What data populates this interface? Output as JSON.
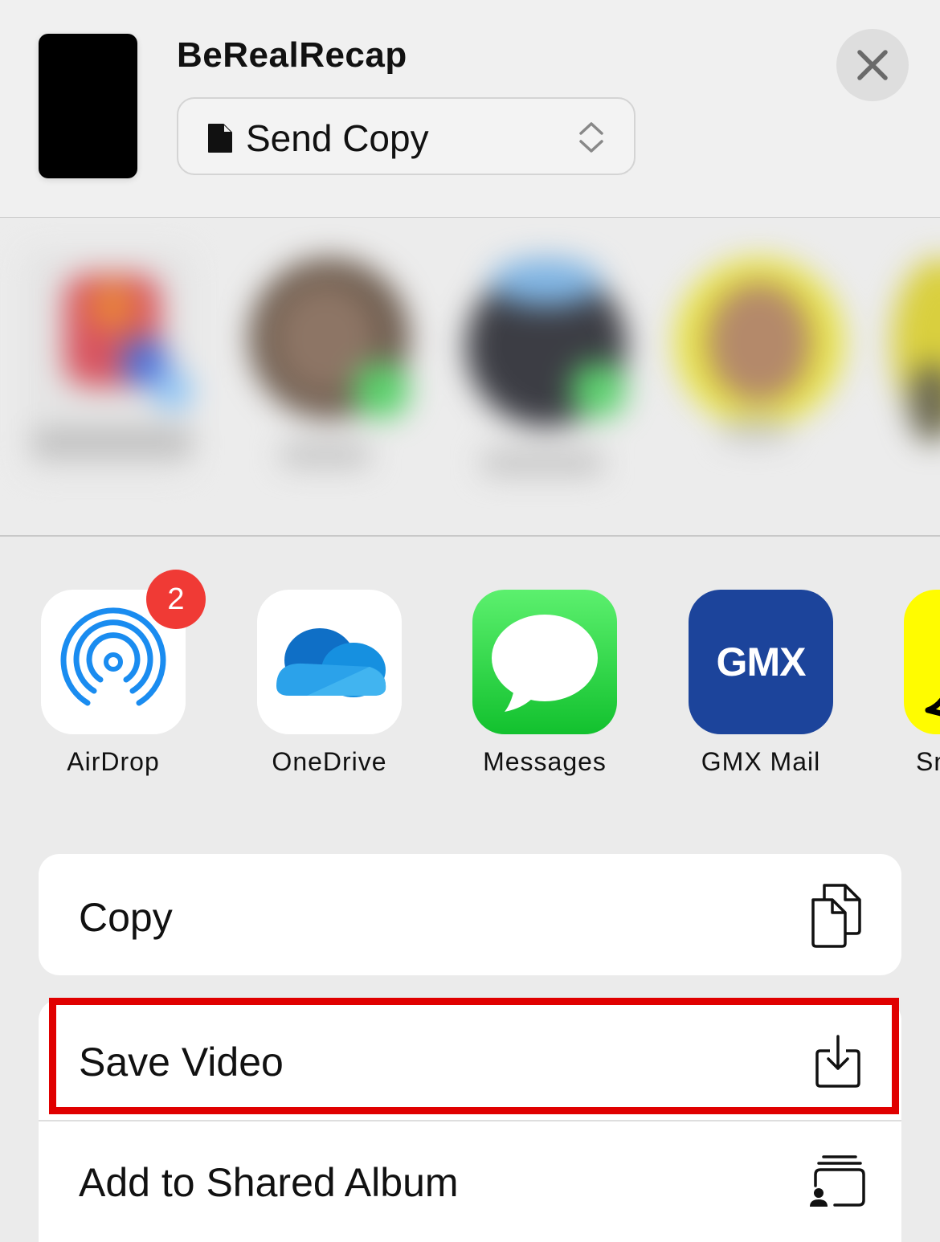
{
  "header": {
    "title": "BeRealRecap",
    "mode_select": {
      "value": "Send Copy"
    }
  },
  "apps": [
    {
      "label": "AirDrop",
      "icon": "airdrop-icon",
      "badge": "2"
    },
    {
      "label": "OneDrive",
      "icon": "onedrive-icon"
    },
    {
      "label": "Messages",
      "icon": "messages-icon"
    },
    {
      "label": "GMX Mail",
      "icon": "gmx-icon",
      "icon_text": "GMX"
    },
    {
      "label": "Sn",
      "icon": "snapchat-icon"
    }
  ],
  "actions": [
    {
      "label": "Copy",
      "icon": "copy-icon"
    },
    {
      "label": "Save Video",
      "icon": "save-icon",
      "highlighted": true
    },
    {
      "label": "Add to Shared Album",
      "icon": "shared-album-icon"
    }
  ],
  "colors": {
    "airdrop": "#1a8cf0",
    "onedrive": "#0f6fc6",
    "messages": "#28c840",
    "gmx": "#1c449b",
    "snapchat": "#fffc00",
    "badge": "#f03a35",
    "highlight": "#e00000"
  }
}
